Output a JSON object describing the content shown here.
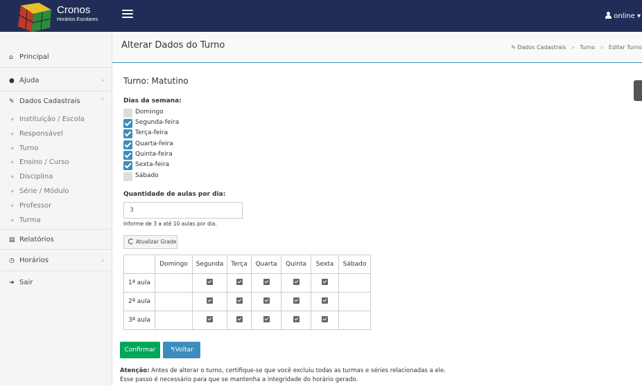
{
  "topbar": {
    "logo_title": "Cronos",
    "logo_subtitle": "Horários Escolares",
    "user_label": "online"
  },
  "sidebar": {
    "items": [
      {
        "label": "Principal",
        "icon": "home-icon"
      },
      {
        "label": "Ajuda",
        "icon": "question-icon",
        "chevron": "‹"
      },
      {
        "label": "Dados Cadastrais",
        "icon": "edit-icon",
        "chevron": "˅"
      },
      {
        "label": "Relatórios",
        "icon": "report-icon"
      },
      {
        "label": "Horários",
        "icon": "clock-icon",
        "chevron": "‹"
      },
      {
        "label": "Sair",
        "icon": "logout-icon"
      }
    ],
    "subitems": [
      "Instituição / Escola",
      "Responsável",
      "Turno",
      "Ensino / Curso",
      "Disciplina",
      "Série / Módulo",
      "Professor",
      "Turma"
    ]
  },
  "header": {
    "title": "Alterar Dados do Turno",
    "breadcrumb": [
      "Dados Cadastrais",
      "Turno",
      "Editar Turno"
    ]
  },
  "form": {
    "turno_title": "Turno: Matutino",
    "days_label": "Dias da semana:",
    "days": [
      {
        "label": "Domingo",
        "checked": false
      },
      {
        "label": "Segunda-feira",
        "checked": true
      },
      {
        "label": "Terça-feira",
        "checked": true
      },
      {
        "label": "Quarta-feira",
        "checked": true
      },
      {
        "label": "Quinta-feira",
        "checked": true
      },
      {
        "label": "Sexta-feira",
        "checked": true
      },
      {
        "label": "Sábado",
        "checked": false
      }
    ],
    "qty_label": "Quantidade de aulas por dia:",
    "qty_value": "3",
    "qty_help": "Informe de 3 a até 10 aulas por dia.",
    "update_grid_label": "Atualizar Grade"
  },
  "grid": {
    "headers": [
      "",
      "Domingo",
      "Segunda",
      "Terça",
      "Quarta",
      "Quinta",
      "Sexta",
      "Sábado"
    ],
    "rows": [
      {
        "label": "1ª aula",
        "checks": [
          false,
          true,
          true,
          true,
          true,
          true,
          false
        ]
      },
      {
        "label": "2ª aula",
        "checks": [
          false,
          true,
          true,
          true,
          true,
          true,
          false
        ]
      },
      {
        "label": "3ª aula",
        "checks": [
          false,
          true,
          true,
          true,
          true,
          true,
          false
        ]
      }
    ]
  },
  "actions": {
    "confirm_label": "Confirmar",
    "back_label": "Voltar"
  },
  "warning": {
    "strong": "Atenção:",
    "line1": " Antes de alterar o turno, certifique-se que você excluiu todas as turmas e séries relacionadas a ele.",
    "line2": "Esse passo é necessário para que se mantenha a integridade do horário gerado."
  },
  "colors": {
    "topbar": "#222d57",
    "primary": "#3c8dbc",
    "success": "#00a65a"
  }
}
